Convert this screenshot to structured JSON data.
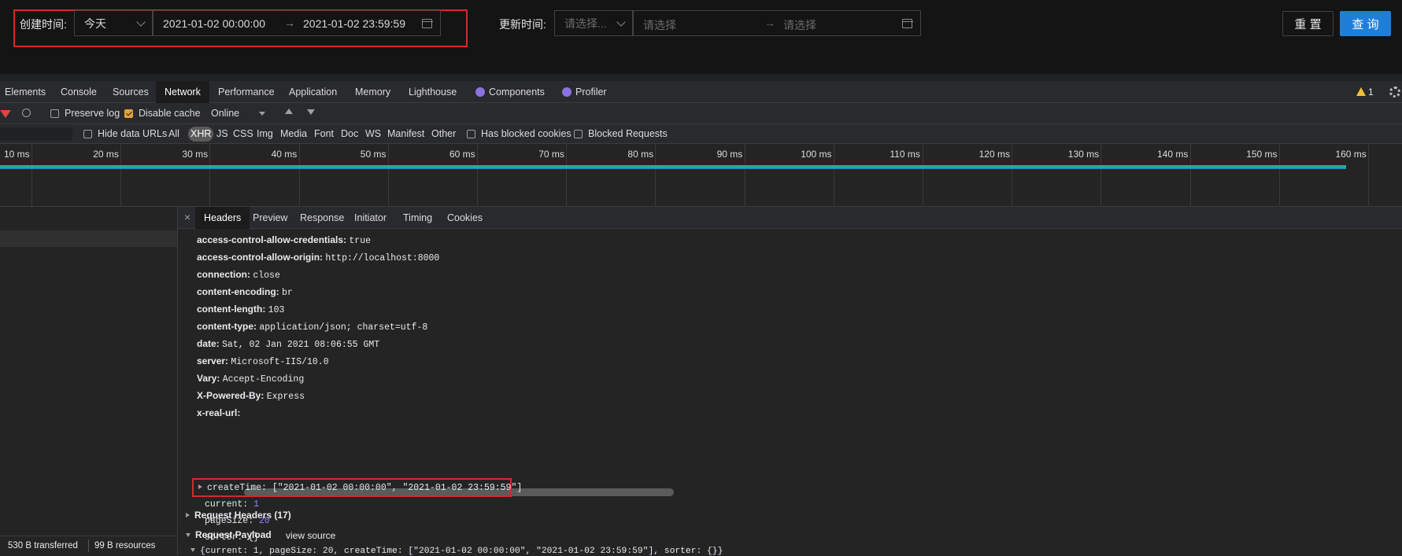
{
  "filters": {
    "create_label": "创建时间:",
    "create_preset": "今天",
    "create_start": "2021-01-02 00:00:00",
    "arrow": "→",
    "create_end": "2021-01-02 23:59:59",
    "update_label": "更新时间:",
    "update_preset_placeholder": "请选择...",
    "update_start_placeholder": "请选择",
    "update_end_placeholder": "请选择",
    "reset_label": "重 置",
    "query_label": "查 询",
    "accent": "#1f7fd8",
    "highlight": "#d42a2a"
  },
  "devtools": {
    "tabs": [
      "Elements",
      "Console",
      "Sources",
      "Network",
      "Performance",
      "Application",
      "Memory",
      "Lighthouse",
      "Components",
      "Profiler"
    ],
    "active_tab": "Network",
    "warning_count": "1",
    "toolbar": {
      "preserve_log": "Preserve log",
      "disable_cache": "Disable cache",
      "throttle": "Online"
    },
    "filterbar": {
      "hide_data_urls": "Hide data URLs",
      "types": [
        "All",
        "XHR",
        "JS",
        "CSS",
        "Img",
        "Media",
        "Font",
        "Doc",
        "WS",
        "Manifest",
        "Other"
      ],
      "active_type": "XHR",
      "blocked_cookies": "Has blocked cookies",
      "blocked_requests": "Blocked Requests"
    },
    "timeline": {
      "ticks": [
        "10 ms",
        "20 ms",
        "30 ms",
        "40 ms",
        "50 ms",
        "60 ms",
        "70 ms",
        "80 ms",
        "90 ms",
        "100 ms",
        "110 ms",
        "120 ms",
        "130 ms",
        "140 ms",
        "150 ms",
        "160 ms"
      ],
      "bar_color": "#1fae8e"
    },
    "detail_tabs": [
      "Headers",
      "Preview",
      "Response",
      "Initiator",
      "Timing",
      "Cookies"
    ],
    "close_glyph": "×",
    "response_headers": [
      {
        "k": "access-control-allow-credentials:",
        "v": "true"
      },
      {
        "k": "access-control-allow-origin:",
        "v": "http://localhost:8000"
      },
      {
        "k": "connection:",
        "v": "close"
      },
      {
        "k": "content-encoding:",
        "v": "br"
      },
      {
        "k": "content-length:",
        "v": "103"
      },
      {
        "k": "content-type:",
        "v": "application/json; charset=utf-8"
      },
      {
        "k": "date:",
        "v": "Sat, 02 Jan 2021 08:06:55 GMT"
      },
      {
        "k": "server:",
        "v": "Microsoft-IIS/10.0"
      },
      {
        "k": "Vary:",
        "v": "Accept-Encoding"
      },
      {
        "k": "X-Powered-By:",
        "v": "Express"
      },
      {
        "k": "x-real-url:",
        "v": ""
      }
    ],
    "request_headers_label": "Request Headers (17)",
    "payload_label": "Request Payload",
    "view_source": "view source",
    "payload_summary": "{current: 1, pageSize: 20, createTime: [\"2021-01-02 00:00:00\", \"2021-01-02 23:59:59\"], sorter: {}}",
    "create_time_line": "createTime: [\"2021-01-02 00:00:00\", \"2021-01-02 23:59:59\"]",
    "payload_fields": [
      {
        "k": "current:",
        "v": "1"
      },
      {
        "k": "pageSize:",
        "v": "20"
      },
      {
        "k": "sorter:",
        "v": "{}"
      }
    ],
    "status": {
      "transferred": "530 B transferred",
      "resources": "99 B resources"
    }
  }
}
